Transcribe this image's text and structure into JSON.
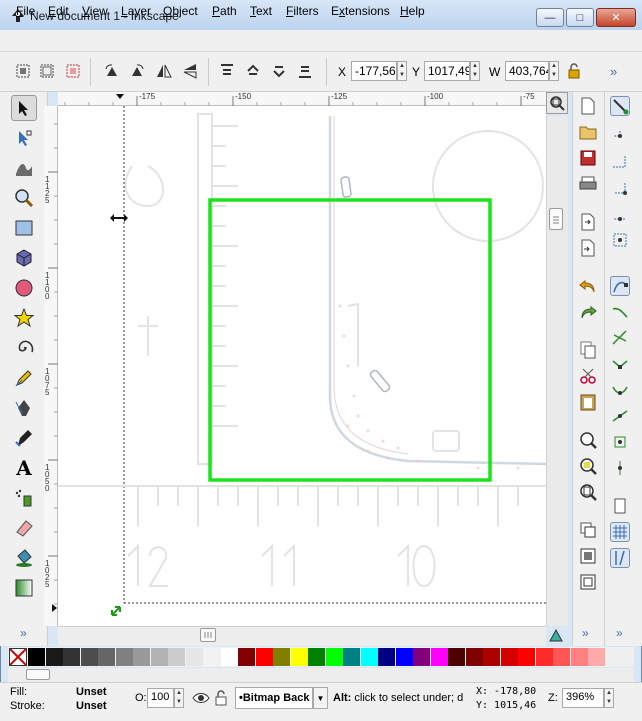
{
  "window": {
    "title": "New document 1 - Inkscape",
    "minimize": "—",
    "maximize": "□",
    "close": "✕"
  },
  "menu": {
    "items": [
      {
        "label": "File",
        "key": "F",
        "rest": "ile"
      },
      {
        "label": "Edit",
        "key": "E",
        "rest": "dit"
      },
      {
        "label": "View",
        "key": "V",
        "rest": "iew"
      },
      {
        "label": "Layer",
        "key": "L",
        "rest": "ayer"
      },
      {
        "label": "Object",
        "key": "O",
        "rest": "bject"
      },
      {
        "label": "Path",
        "key": "P",
        "rest": "ath"
      },
      {
        "label": "Text",
        "key": "T",
        "rest": "ext"
      },
      {
        "label": "Filters",
        "key": "F",
        "rest": "ilters"
      },
      {
        "label": "Extensions",
        "key": "x",
        "rest": "tensions",
        "prefix": "E"
      },
      {
        "label": "Help",
        "key": "H",
        "rest": "elp"
      }
    ]
  },
  "controls": {
    "x_label": "X",
    "x_value": "-177,566",
    "y_label": "Y",
    "y_value": "1017,49",
    "w_label": "W",
    "w_value": "403,764",
    "more": "»"
  },
  "rulers": {
    "top_labels": [
      "-175",
      "-150",
      "-125",
      "-100",
      "-75"
    ],
    "left_labels": [
      "1125",
      "1100",
      "1075",
      "1050",
      "1025"
    ]
  },
  "toolbox": {
    "tools": [
      "selector-tool",
      "node-tool",
      "tweak-tool",
      "zoom-tool",
      "rectangle-tool",
      "3d-box-tool",
      "ellipse-tool",
      "star-tool",
      "spiral-tool",
      "pencil-tool",
      "pen-tool",
      "calligraphy-tool",
      "text-tool",
      "spray-tool",
      "eraser-tool",
      "paint-bucket-tool",
      "gradient-tool"
    ],
    "more": "»"
  },
  "palette": {
    "colors": [
      "#000000",
      "#1a1a1a",
      "#333333",
      "#4d4d4d",
      "#666666",
      "#808080",
      "#999999",
      "#b3b3b3",
      "#cccccc",
      "#e6e6e6",
      "#f2f2f2",
      "#ffffff",
      "#800000",
      "#ff0000",
      "#808000",
      "#ffff00",
      "#008000",
      "#00ff00",
      "#008080",
      "#00ffff",
      "#000080",
      "#0000ff",
      "#800080",
      "#ff00ff",
      "#4d0000",
      "#800000",
      "#aa0000",
      "#d40000",
      "#ff0000",
      "#ff2a2a",
      "#ff5555",
      "#ff8080",
      "#ffaaaa"
    ]
  },
  "status": {
    "fill_label": "Fill:",
    "fill_value": "Unset",
    "stroke_label": "Stroke:",
    "stroke_value": "Unset",
    "opacity_label": "O:",
    "opacity_value": "100",
    "layer_name": "•Bitmap Back",
    "message_bold": "Alt:",
    "message": " click to select under; d",
    "cursor_x": "X: -178,80",
    "cursor_y": "Y: 1015,46",
    "zoom_label": "Z:",
    "zoom_value": "396%"
  },
  "colors": {
    "selection": "#1fe21f",
    "accent": "#3b6fb6"
  }
}
